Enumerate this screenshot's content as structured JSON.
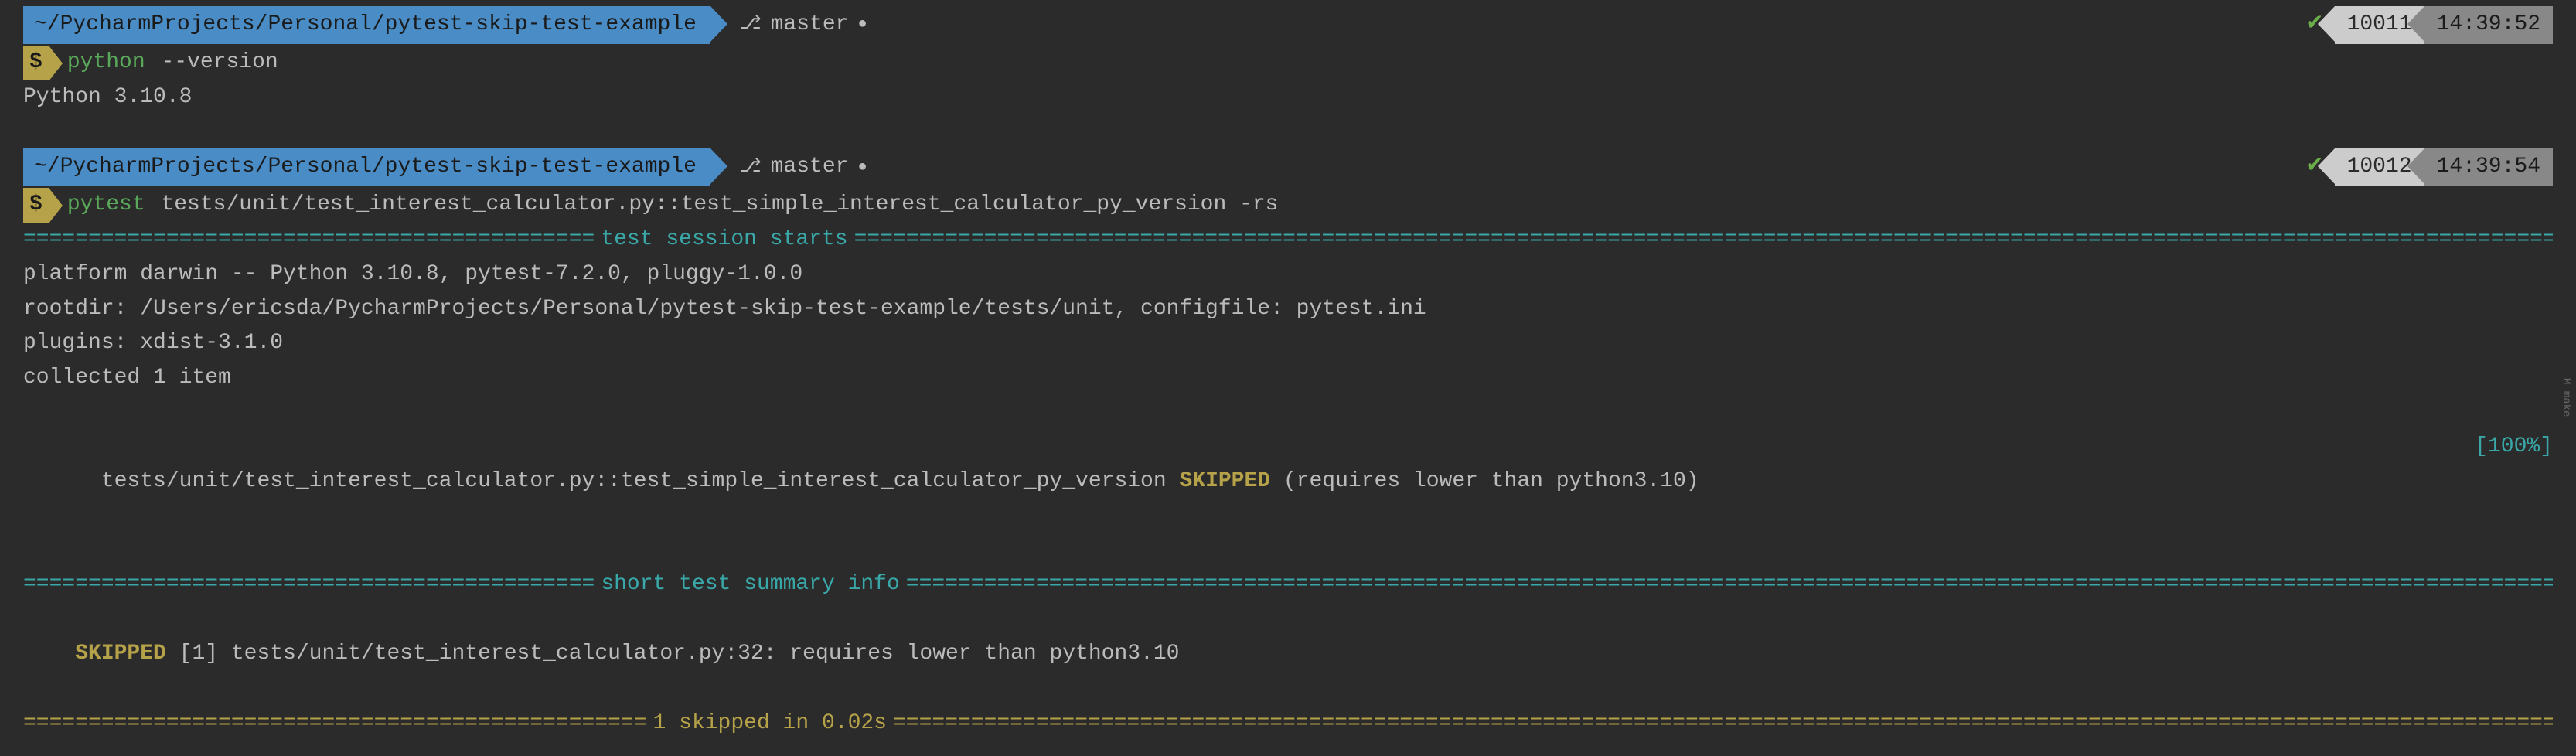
{
  "block1": {
    "path": "~/PycharmProjects/Personal/pytest-skip-test-example",
    "branch": "master",
    "branch_dot": "●",
    "check": "✔",
    "history_num": "10011",
    "time": "14:39:52",
    "prompt_symbol": "$",
    "command": "python",
    "args": "--version",
    "output": "Python 3.10.8"
  },
  "block2": {
    "path": "~/PycharmProjects/Personal/pytest-skip-test-example",
    "branch": "master",
    "branch_dot": "●",
    "check": "✔",
    "history_num": "10012",
    "time": "14:39:54",
    "prompt_symbol": "$",
    "command": "pytest",
    "args": "tests/unit/test_interest_calculator.py::test_simple_interest_calculator_py_version -rs",
    "session_header": "test session starts",
    "platform_line": "platform darwin -- Python 3.10.8, pytest-7.2.0, pluggy-1.0.0",
    "rootdir_line": "rootdir: /Users/ericsda/PycharmProjects/Personal/pytest-skip-test-example/tests/unit, configfile: pytest.ini",
    "plugins_line": "plugins: xdist-3.1.0",
    "collected_line": "collected 1 item",
    "test_path": "tests/unit/test_interest_calculator.py::test_simple_interest_calculator_py_version ",
    "test_status": "SKIPPED",
    "test_reason": " (requires lower than python3.10)",
    "test_pct": "[100%]",
    "summary_header": "short test summary info",
    "summary_status": "SKIPPED",
    "summary_detail": " [1] tests/unit/test_interest_calculator.py:32: requires lower than python3.10",
    "footer": "1 skipped in 0.02s"
  },
  "eq44": "============================================",
  "eq48": "================================================",
  "sidebar": "M make"
}
